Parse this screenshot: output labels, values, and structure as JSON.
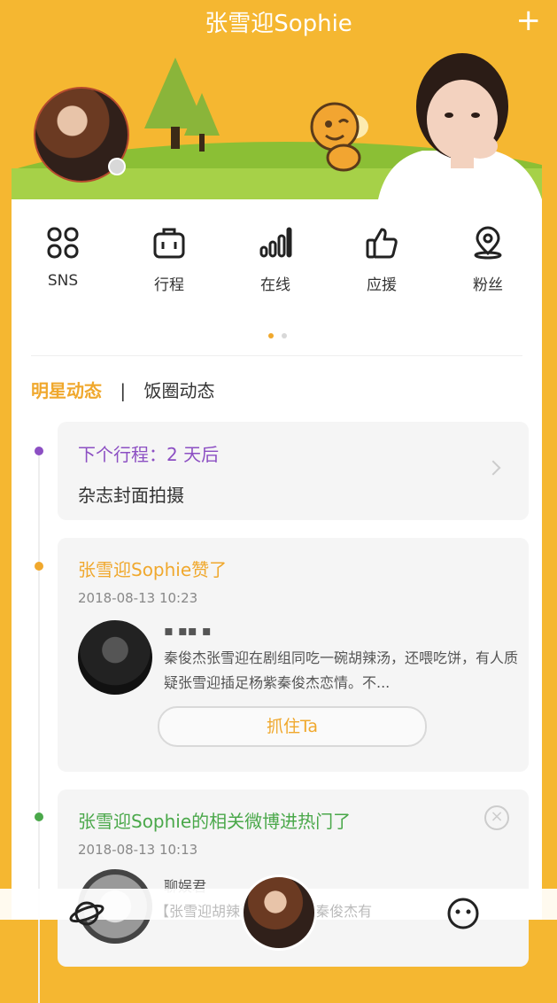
{
  "header": {
    "title": "张雪迎Sophie",
    "plus_icon": "plus-icon"
  },
  "nav": [
    {
      "label": "SNS",
      "icon": "grid-icon"
    },
    {
      "label": "行程",
      "icon": "suitcase-icon"
    },
    {
      "label": "在线",
      "icon": "signal-bars-icon"
    },
    {
      "label": "应援",
      "icon": "thumbs-up-icon"
    },
    {
      "label": "粉丝",
      "icon": "location-pin-icon"
    }
  ],
  "tabs": {
    "active": "明星动态",
    "separator": "|",
    "inactive": "饭圈动态"
  },
  "feed": [
    {
      "heading": "下个行程：2 天后",
      "subtitle": "杂志封面拍摄"
    },
    {
      "heading": "张雪迎Sophie赞了",
      "time": "2018-08-13 10:23",
      "text": "秦俊杰张雪迎在剧组同吃一碗胡辣汤，还喂吃饼，有人质疑张雪迎插足杨紫秦俊杰恋情。不...",
      "button": "抓住Ta"
    },
    {
      "heading": "张雪迎Sophie的相关微博进热门了",
      "time": "2018-08-13 10:13",
      "user": "聊娱君",
      "text": "【张雪迎胡辣汤 八月杨紫秦俊杰有"
    }
  ],
  "colors": {
    "accent": "#f0a82d",
    "purple": "#8c4fc3",
    "green": "#4aa84a",
    "background": "#f5b731"
  }
}
